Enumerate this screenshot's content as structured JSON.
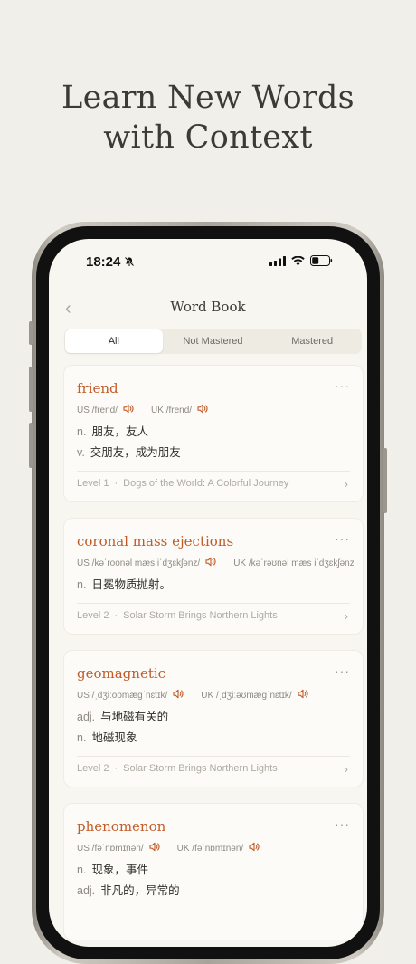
{
  "headline": {
    "line1": "Learn New Words",
    "line2": "with Context"
  },
  "status": {
    "time": "18:24"
  },
  "nav": {
    "back": "‹",
    "title": "Word Book"
  },
  "tabs": [
    {
      "label": "All",
      "active": true
    },
    {
      "label": "Not Mastered",
      "active": false
    },
    {
      "label": "Mastered",
      "active": false
    }
  ],
  "cards": [
    {
      "word": "friend",
      "us": "US /frend/",
      "uk": "UK /frend/",
      "defs": [
        {
          "pos": "n.",
          "text": "朋友，友人"
        },
        {
          "pos": "v.",
          "text": "交朋友，成为朋友"
        }
      ],
      "level": "Level 1",
      "source": "Dogs of the World: A Colorful Journey"
    },
    {
      "word": "coronal mass ejections",
      "us": "US /kəˈroonəl mæs iˈdʒɛkʃənz/",
      "uk": "UK /kəˈrəʊnəl mæs iˈdʒɛkʃənz/",
      "defs": [
        {
          "pos": "n.",
          "text": "日冕物质抛射。"
        }
      ],
      "level": "Level 2",
      "source": "Solar Storm Brings Northern Lights"
    },
    {
      "word": "geomagnetic",
      "us": "US /ˌdʒiːoomægˈnɛtɪk/",
      "uk": "UK /ˌdʒiːəʊmægˈnɛtɪk/",
      "defs": [
        {
          "pos": "adj.",
          "text": "与地磁有关的"
        },
        {
          "pos": "n.",
          "text": "地磁现象"
        }
      ],
      "level": "Level 2",
      "source": "Solar Storm Brings Northern Lights"
    },
    {
      "word": "phenomenon",
      "us": "US /fəˈnɒmɪnən/",
      "uk": "UK /fəˈnɒmɪnən/",
      "defs": [
        {
          "pos": "n.",
          "text": "现象，事件"
        },
        {
          "pos": "adj.",
          "text": "非凡的，异常的"
        }
      ],
      "level": "",
      "source": ""
    }
  ],
  "ui": {
    "more": "···",
    "chevron": "›",
    "separator": "·"
  },
  "colors": {
    "accent": "#c15c2a",
    "background": "#f1efe9",
    "screen": "#f8f6f0"
  }
}
